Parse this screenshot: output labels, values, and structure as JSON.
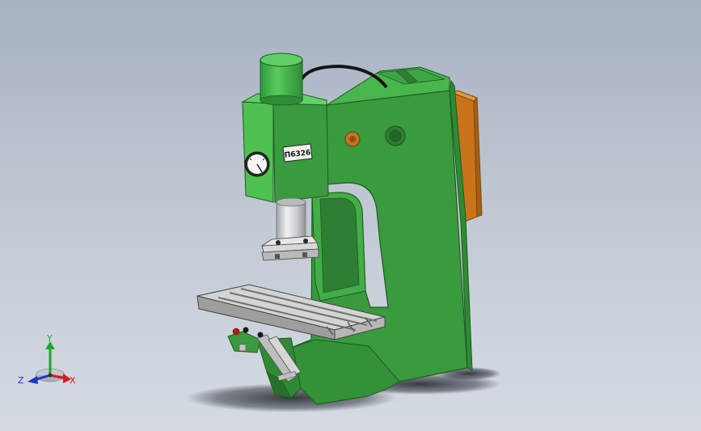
{
  "viewport": {
    "background_top": "#a6b1c1",
    "background_bottom": "#d6dbe2"
  },
  "model": {
    "nameplate": "П6326",
    "body_color": "#3a9a3e",
    "highlight_color": "#4fc152",
    "shadow_color": "#2e7e33",
    "cabinet_color": "#d17d1b",
    "table_color": "#c9c9c9"
  },
  "triad": {
    "x_label": "X",
    "y_label": "Y",
    "z_label": "Z",
    "x_color": "#d11a1a",
    "y_color": "#1ba82c",
    "z_color": "#2033c9"
  }
}
